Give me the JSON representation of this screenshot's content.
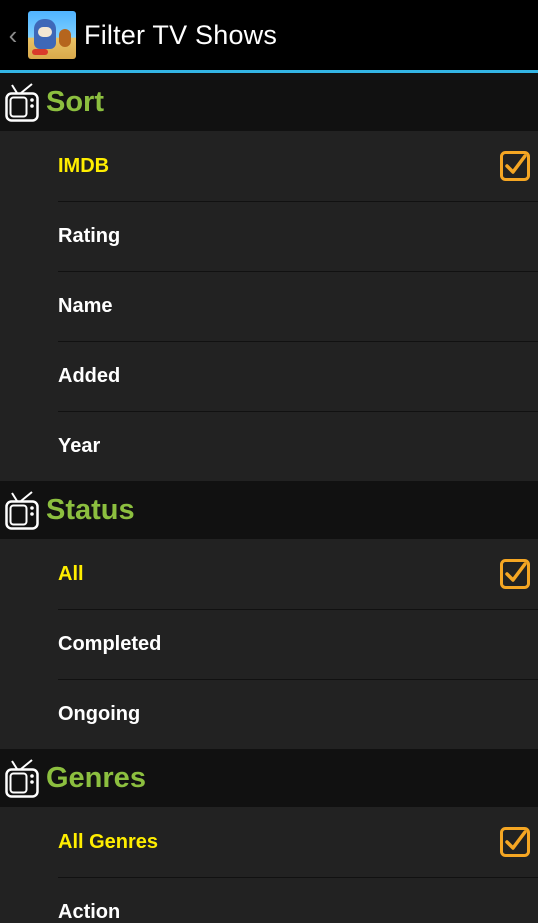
{
  "action_bar": {
    "back_glyph": "‹",
    "title": "Filter TV Shows",
    "icon": "app-logo-cartoon-cat-mouse"
  },
  "colors": {
    "section_title": "#8cbf3f",
    "selected_item": "#ffee00",
    "accent_line": "#33b5e5",
    "checkbox": "#f5a623"
  },
  "sections": [
    {
      "title": "Sort",
      "icon": "tv-icon",
      "items": [
        {
          "label": "IMDB",
          "checked": true
        },
        {
          "label": "Rating",
          "checked": false
        },
        {
          "label": "Name",
          "checked": false
        },
        {
          "label": "Added",
          "checked": false
        },
        {
          "label": "Year",
          "checked": false
        }
      ]
    },
    {
      "title": "Status",
      "icon": "tv-icon",
      "items": [
        {
          "label": "All",
          "checked": true
        },
        {
          "label": "Completed",
          "checked": false
        },
        {
          "label": "Ongoing",
          "checked": false
        }
      ]
    },
    {
      "title": "Genres",
      "icon": "tv-icon",
      "items": [
        {
          "label": "All Genres",
          "checked": true
        },
        {
          "label": "Action",
          "checked": false
        }
      ]
    }
  ]
}
